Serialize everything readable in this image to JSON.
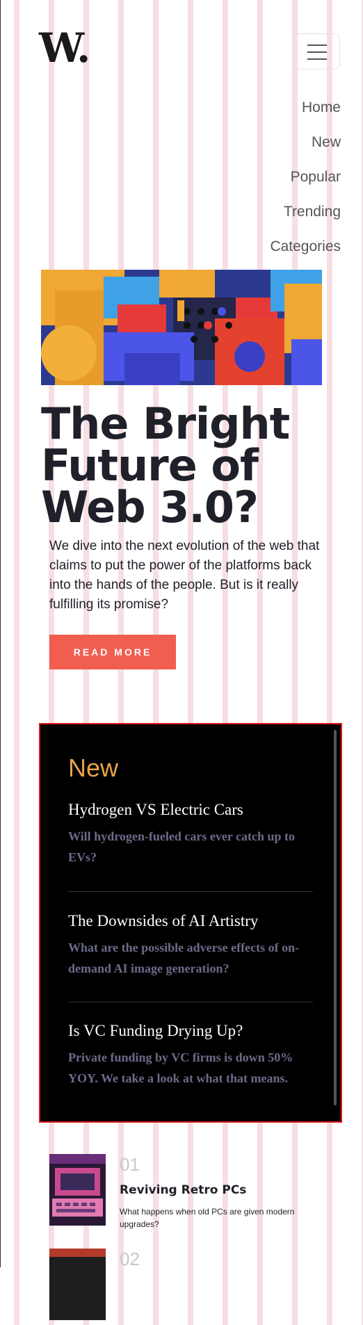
{
  "header": {
    "logo": "W.",
    "menu_icon": "hamburger-menu-icon"
  },
  "nav": {
    "items": [
      {
        "label": "Home"
      },
      {
        "label": "New"
      },
      {
        "label": "Popular"
      },
      {
        "label": "Trending"
      },
      {
        "label": "Categories"
      }
    ]
  },
  "hero": {
    "title": "The Bright Future of Web 3.0?",
    "description": "We dive into the next evolution of the web that claims to put the power of the platforms back into the hands of the people. But is it really fulfilling its promise?",
    "button_label": "READ MORE",
    "accent_color": "#f15e50"
  },
  "new_section": {
    "heading": "New",
    "heading_color": "#e9a24b",
    "items": [
      {
        "title": "Hydrogen VS Electric Cars",
        "description": "Will hydrogen-fueled cars ever catch up to EVs?"
      },
      {
        "title": "The Downsides of AI Artistry",
        "description": "What are the possible adverse effects of on-demand AI image generation?"
      },
      {
        "title": "Is VC Funding Drying Up?",
        "description": "Private funding by VC firms is down 50% YOY. We take a look at what that means."
      }
    ]
  },
  "ranked": {
    "items": [
      {
        "number": "01",
        "title": "Reviving Retro PCs",
        "description": "What happens when old PCs are given modern upgrades?"
      },
      {
        "number": "02",
        "title": "",
        "description": ""
      }
    ]
  }
}
